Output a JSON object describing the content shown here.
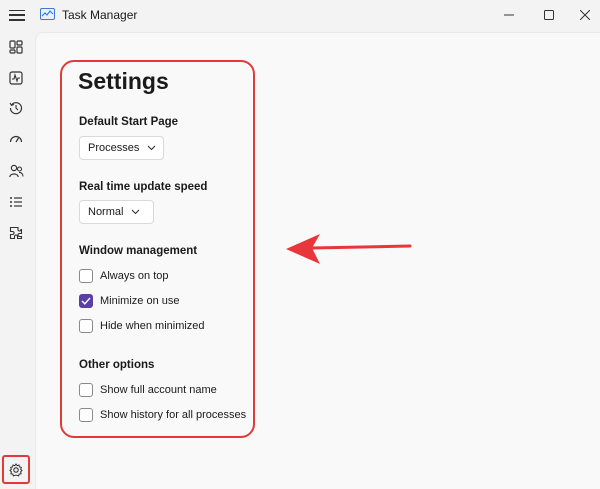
{
  "window": {
    "title": "Task Manager"
  },
  "sidebar": {
    "items": [
      {
        "icon": "processes-icon"
      },
      {
        "icon": "performance-icon"
      },
      {
        "icon": "app-history-icon"
      },
      {
        "icon": "startup-apps-icon"
      },
      {
        "icon": "users-icon"
      },
      {
        "icon": "details-icon"
      },
      {
        "icon": "services-icon"
      }
    ],
    "settings_icon": "gear-icon"
  },
  "settings": {
    "heading": "Settings",
    "default_start_page": {
      "label": "Default Start Page",
      "value": "Processes"
    },
    "update_speed": {
      "label": "Real time update speed",
      "value": "Normal"
    },
    "window_management": {
      "label": "Window management",
      "options": [
        {
          "label": "Always on top",
          "checked": false
        },
        {
          "label": "Minimize on use",
          "checked": true
        },
        {
          "label": "Hide when minimized",
          "checked": false
        }
      ]
    },
    "other_options": {
      "label": "Other options",
      "options": [
        {
          "label": "Show full account name",
          "checked": false
        },
        {
          "label": "Show history for all processes",
          "checked": false
        }
      ]
    }
  },
  "colors": {
    "accent": "#5b3fa6",
    "highlight": "#e03a3a"
  }
}
